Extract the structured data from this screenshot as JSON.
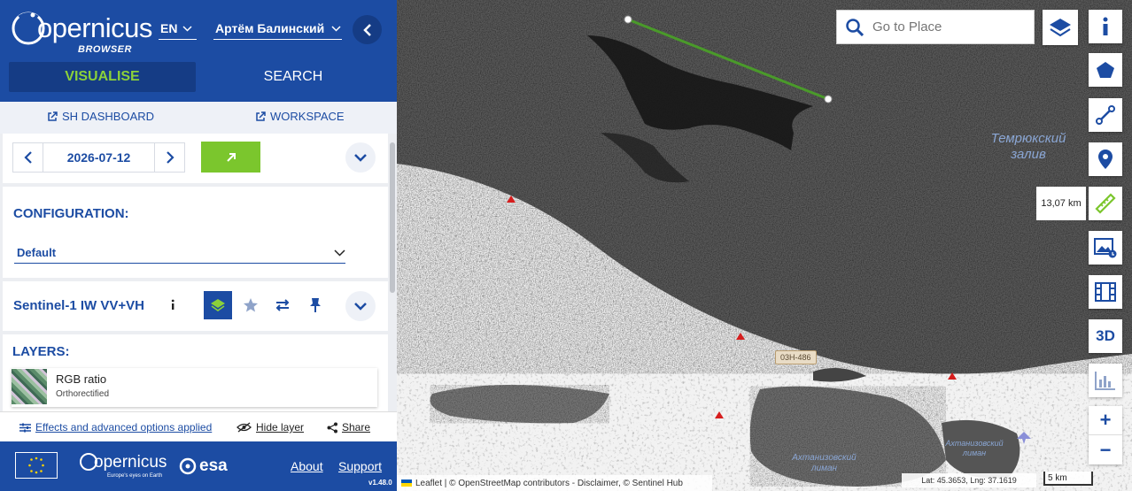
{
  "header": {
    "logo_word": "opernicus",
    "logo_sub": "BROWSER",
    "language": "EN",
    "user": "Артём Балинский",
    "tabs": {
      "visualise": "VISUALISE",
      "search": "SEARCH"
    }
  },
  "links": {
    "dashboard": "SH DASHBOARD",
    "workspace": "WORKSPACE"
  },
  "date_picker": {
    "value": "2026-07-12"
  },
  "configuration": {
    "title": "CONFIGURATION:",
    "selected": "Default"
  },
  "dataset": {
    "name": "Sentinel-1 IW VV+VH"
  },
  "layers": {
    "title": "LAYERS:",
    "items": [
      {
        "title": "RGB ratio",
        "subtitle": "Orthorectified"
      }
    ]
  },
  "actions": {
    "effects": "Effects and advanced options applied",
    "hide": "Hide layer",
    "share": "Share"
  },
  "footer": {
    "about": "About",
    "support": "Support",
    "version": "v1.48.0",
    "copernicus_tagline": "Europe's eyes on Earth",
    "esa": "esa"
  },
  "map": {
    "search_placeholder": "Go to Place",
    "measure_distance": "13,07 km",
    "road_label": "03Н-486",
    "labels": {
      "gulf": "Темрюкский залив",
      "liman_left": "Ахтанизовский лиман",
      "liman_right": "Ахтанизовский лиман"
    },
    "attribution": "Leaflet | © OpenStreetMap contributors - Disclaimer, © Sentinel Hub",
    "coords": "Lat: 45.3653, Lng: 37.1619",
    "scale": "5 km",
    "three_d": "3D",
    "zoom_in": "+",
    "zoom_out": "−"
  },
  "colors": {
    "brand_blue": "#1c4ca3",
    "accent_green": "#7bc62d",
    "measure_line": "#4a9a2a"
  }
}
